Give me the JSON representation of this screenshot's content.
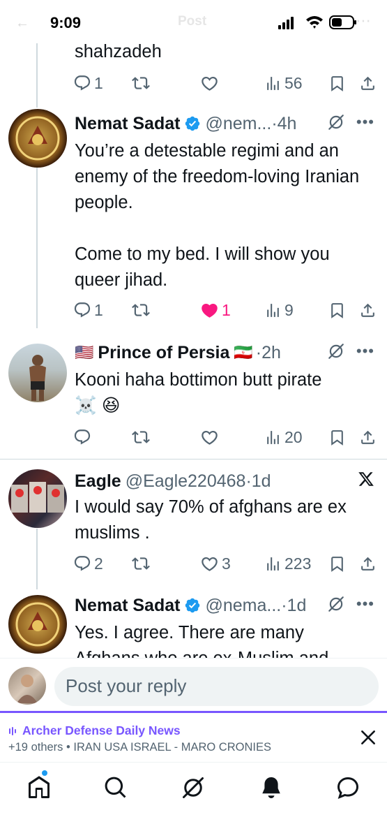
{
  "status_bar": {
    "time": "9:09",
    "faded_title": "Post"
  },
  "top_post": {
    "text_tail": "shahzadeh",
    "replies": "1",
    "reposts": "",
    "likes": "",
    "views": "56"
  },
  "posts": [
    {
      "name": "Nemat Sadat",
      "verified": true,
      "handle": "@nem...",
      "dot": "·",
      "time": "4h",
      "text": "You’re a detestable regimi and an enemy of the freedom-loving Iranian people.\n\nCome to my bed. I will show you queer jihad.",
      "replies": "1",
      "reposts": "",
      "likes": "1",
      "liked": true,
      "views": "9",
      "avatar_icon": "golden-emblem-avatar"
    },
    {
      "name_prefix_flag": "🇺🇸",
      "name": "Prince of Persia",
      "name_suffix_flag": "🇮🇷",
      "dot": "·",
      "time": "2h",
      "text": "Kooni haha bottimon butt pirate",
      "emoji": "☠️ 😆",
      "replies": "",
      "reposts": "",
      "likes": "",
      "views": "20",
      "avatar_icon": "boxer-photo-avatar"
    },
    {
      "name": "Eagle",
      "handle": "@Eagle220468",
      "dot": "·",
      "time": "1d",
      "text": "I would say 70% of afghans are ex muslims .",
      "replies": "2",
      "reposts": "",
      "likes": "3",
      "views": "223",
      "avatar_icon": "collage-avatar"
    },
    {
      "name": "Nemat Sadat",
      "verified": true,
      "handle": "@nema...",
      "dot": "·",
      "time": "1d",
      "text": "Yes. I agree. There are many",
      "text_cut": "Afghans who are ex-Muslim and",
      "avatar_icon": "golden-emblem-avatar"
    }
  ],
  "reply_bar": {
    "placeholder": "Post your reply"
  },
  "space_bar": {
    "title": "Archer Defense Daily News",
    "subtitle": "+19 others • IRAN USA ISRAEL - MARO CRONIES"
  },
  "tabs": [
    "home-icon",
    "search-icon",
    "grok-icon",
    "notifications-icon",
    "messages-icon"
  ],
  "colors": {
    "accent": "#1d9bf0",
    "like": "#f91880",
    "spaces": "#7856ff",
    "muted": "#536471"
  }
}
